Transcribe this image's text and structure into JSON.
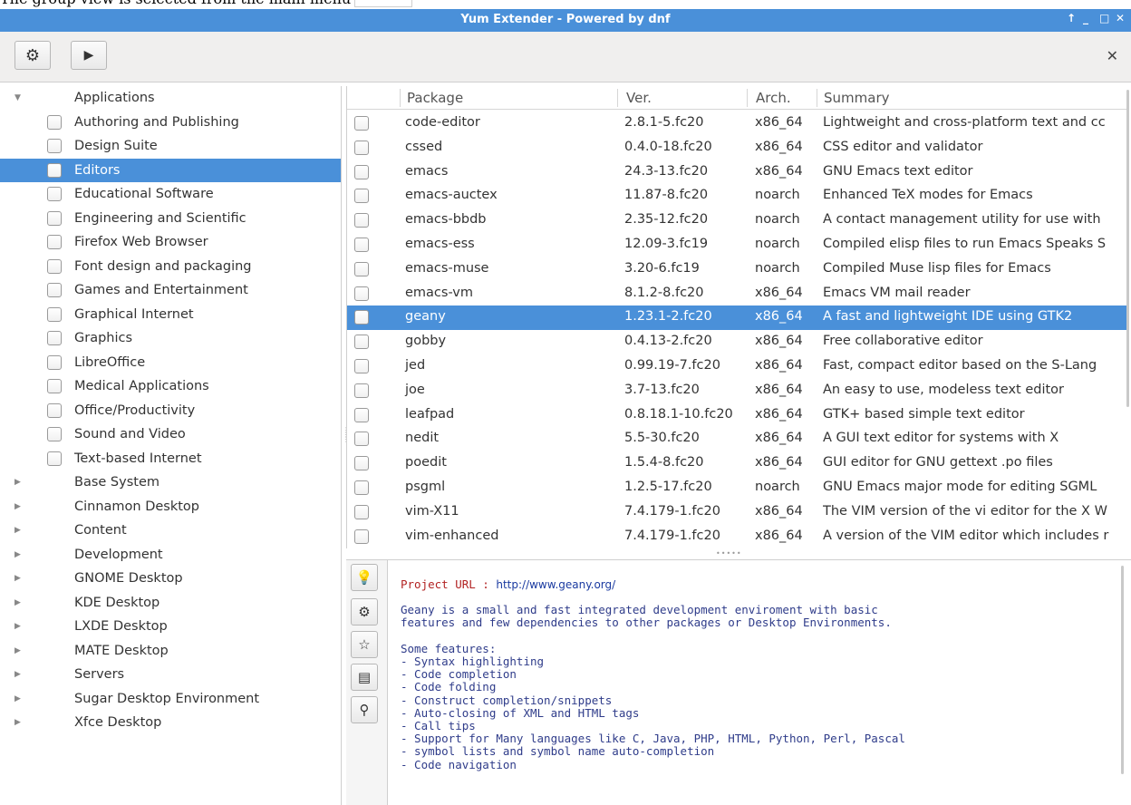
{
  "caption": {
    "text": "The group view is selected from the main menu"
  },
  "window": {
    "title": "Yum Extender - Powered by dnf",
    "controls": [
      "↑",
      "_",
      "□",
      "✕"
    ]
  },
  "toolbar": {
    "close": "✕"
  },
  "sidebar_tree": {
    "applications": "Applications",
    "children": [
      "Authoring and Publishing",
      "Design Suite",
      "Editors",
      "Educational Software",
      "Engineering and Scientific",
      "Firefox Web Browser",
      "Font design and packaging",
      "Games and Entertainment",
      "Graphical Internet",
      "Graphics",
      "LibreOffice",
      "Medical Applications",
      "Office/Productivity",
      "Sound and Video",
      "Text-based Internet"
    ],
    "groups": [
      "Base System",
      "Cinnamon Desktop",
      "Content",
      "Development",
      "GNOME Desktop",
      "KDE Desktop",
      "LXDE Desktop",
      "MATE Desktop",
      "Servers",
      "Sugar Desktop Environment",
      "Xfce Desktop"
    ],
    "selected": "Editors"
  },
  "packages": {
    "headers": {
      "package": "Package",
      "ver": "Ver.",
      "arch": "Arch.",
      "summary": "Summary"
    },
    "rows": [
      {
        "name": "code-editor",
        "ver": "2.8.1-5.fc20",
        "arch": "x86_64",
        "summary": "Lightweight and cross-platform text and cc"
      },
      {
        "name": "cssed",
        "ver": "0.4.0-18.fc20",
        "arch": "x86_64",
        "summary": "CSS editor and validator"
      },
      {
        "name": "emacs",
        "ver": "24.3-13.fc20",
        "arch": "x86_64",
        "summary": "GNU Emacs text editor"
      },
      {
        "name": "emacs-auctex",
        "ver": "11.87-8.fc20",
        "arch": "noarch",
        "summary": "Enhanced TeX modes for Emacs"
      },
      {
        "name": "emacs-bbdb",
        "ver": "2.35-12.fc20",
        "arch": "noarch",
        "summary": "A contact management utility for use with"
      },
      {
        "name": "emacs-ess",
        "ver": "12.09-3.fc19",
        "arch": "noarch",
        "summary": "Compiled elisp files to run Emacs Speaks S"
      },
      {
        "name": "emacs-muse",
        "ver": "3.20-6.fc19",
        "arch": "noarch",
        "summary": "Compiled Muse lisp files for Emacs"
      },
      {
        "name": "emacs-vm",
        "ver": "8.1.2-8.fc20",
        "arch": "x86_64",
        "summary": "Emacs VM mail reader"
      },
      {
        "name": "geany",
        "ver": "1.23.1-2.fc20",
        "arch": "x86_64",
        "summary": "A fast and lightweight IDE using GTK2"
      },
      {
        "name": "gobby",
        "ver": "0.4.13-2.fc20",
        "arch": "x86_64",
        "summary": "Free collaborative editor"
      },
      {
        "name": "jed",
        "ver": "0.99.19-7.fc20",
        "arch": "x86_64",
        "summary": "Fast, compact editor based on the S-Lang"
      },
      {
        "name": "joe",
        "ver": "3.7-13.fc20",
        "arch": "x86_64",
        "summary": "An easy to use, modeless text editor"
      },
      {
        "name": "leafpad",
        "ver": "0.8.18.1-10.fc20",
        "arch": "x86_64",
        "summary": "GTK+ based simple text editor"
      },
      {
        "name": "nedit",
        "ver": "5.5-30.fc20",
        "arch": "x86_64",
        "summary": "A GUI text editor for systems with X"
      },
      {
        "name": "poedit",
        "ver": "1.5.4-8.fc20",
        "arch": "x86_64",
        "summary": "GUI editor for GNU gettext .po files"
      },
      {
        "name": "psgml",
        "ver": "1.2.5-17.fc20",
        "arch": "noarch",
        "summary": "GNU Emacs major mode for editing SGML"
      },
      {
        "name": "vim-X11",
        "ver": "7.4.179-1.fc20",
        "arch": "x86_64",
        "summary": "The VIM version of the vi editor for the X W"
      },
      {
        "name": "vim-enhanced",
        "ver": "7.4.179-1.fc20",
        "arch": "x86_64",
        "summary": "A version of the VIM editor which includes r"
      }
    ],
    "selected": "geany"
  },
  "info": {
    "url_label": "Project URL : ",
    "url_value": "http://www.geany.org/",
    "lines": [
      "Geany is a small and fast integrated development enviroment with basic",
      "features and few dependencies to other packages or Desktop Environments.",
      "",
      "Some features:",
      "- Syntax highlighting",
      "- Code completion",
      "- Code folding",
      "- Construct completion/snippets",
      "- Auto-closing of XML and HTML tags",
      "- Call tips",
      "- Support for Many languages like C, Java, PHP, HTML, Python, Perl, Pascal",
      "- symbol lists and symbol name auto-completion",
      "- Code navigation"
    ]
  },
  "colors": {
    "accent": "#4a90d9",
    "url_label": "#b22222",
    "info_text": "#2f3c8a"
  }
}
